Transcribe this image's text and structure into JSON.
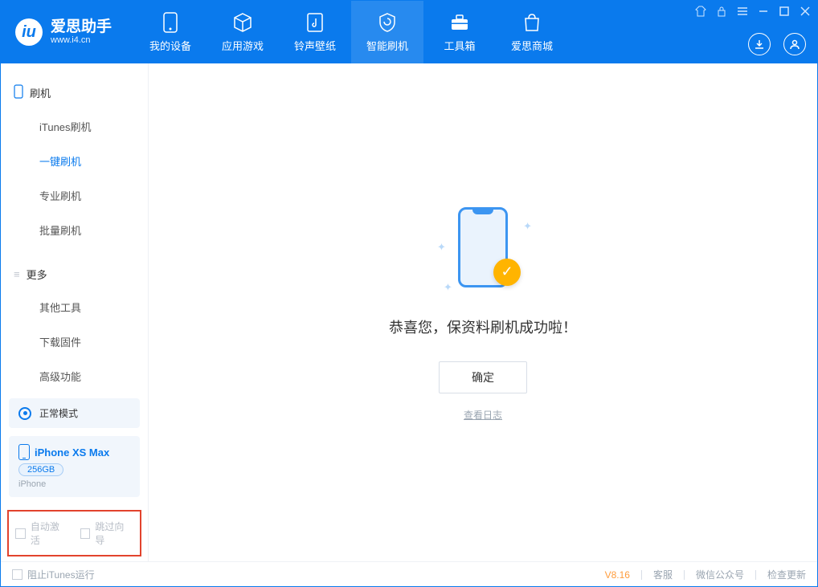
{
  "logo": {
    "title": "爱思助手",
    "sub": "www.i4.cn"
  },
  "nav": {
    "items": [
      {
        "label": "我的设备"
      },
      {
        "label": "应用游戏"
      },
      {
        "label": "铃声壁纸"
      },
      {
        "label": "智能刷机"
      },
      {
        "label": "工具箱"
      },
      {
        "label": "爱思商城"
      }
    ]
  },
  "sidebar": {
    "group1": {
      "title": "刷机",
      "items": [
        "iTunes刷机",
        "一键刷机",
        "专业刷机",
        "批量刷机"
      ]
    },
    "group2": {
      "title": "更多",
      "items": [
        "其他工具",
        "下载固件",
        "高级功能"
      ]
    },
    "mode": {
      "label": "正常模式"
    },
    "device": {
      "name": "iPhone XS Max",
      "storage": "256GB",
      "type": "iPhone"
    },
    "opts": {
      "auto_activate": "自动激活",
      "skip_guide": "跳过向导"
    }
  },
  "main": {
    "success": "恭喜您，保资料刷机成功啦！",
    "ok": "确定",
    "log": "查看日志"
  },
  "footer": {
    "stop_itunes": "阻止iTunes运行",
    "version": "V8.16",
    "kefu": "客服",
    "wechat": "微信公众号",
    "update": "检查更新"
  }
}
